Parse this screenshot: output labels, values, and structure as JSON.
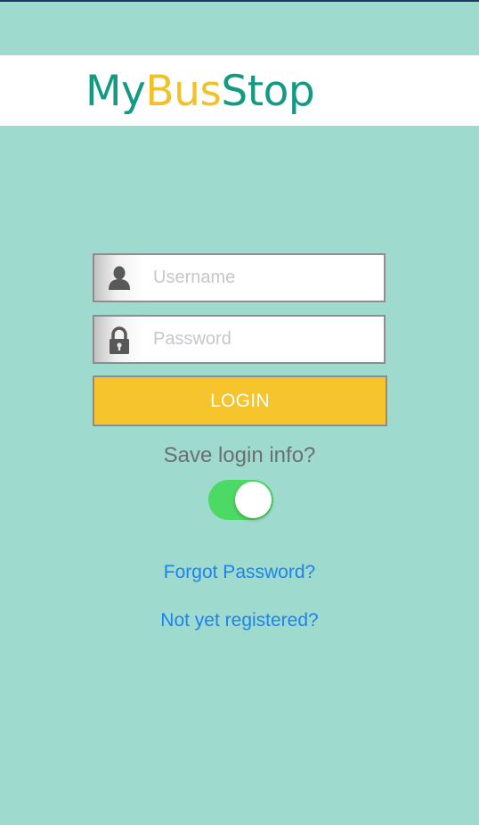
{
  "header": {
    "logo_part1": "My",
    "logo_part2": "Bus",
    "logo_part3": "Stop"
  },
  "login_form": {
    "username_placeholder": "Username",
    "password_placeholder": "Password",
    "login_label": "LOGIN",
    "save_login_label": "Save login info?",
    "save_login_enabled": true,
    "forgot_password_label": "Forgot Password?",
    "register_label": "Not yet registered?"
  },
  "colors": {
    "background": "#9fdacf",
    "brand_green": "#129b82",
    "brand_yellow": "#f2c12a",
    "login_button": "#f6c42d",
    "toggle_on": "#4cd964",
    "link": "#1d83ee"
  },
  "icons": {
    "username": "user-icon",
    "password": "lock-icon"
  }
}
